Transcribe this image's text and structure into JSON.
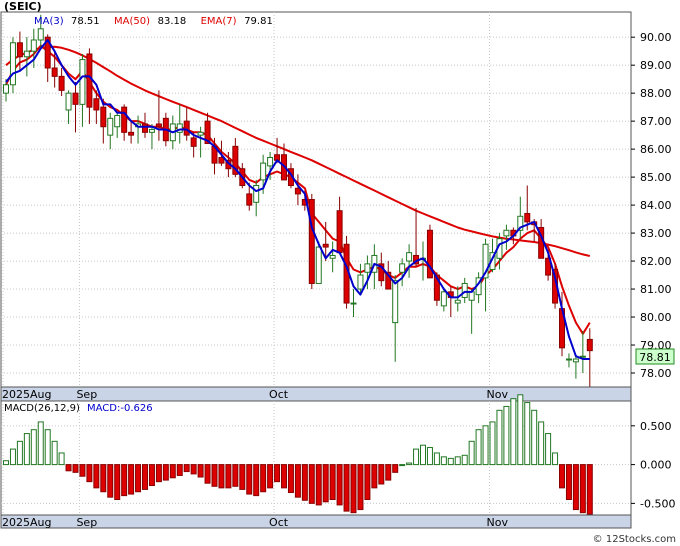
{
  "chart_data": [
    {
      "type": "candlestick",
      "title": "(SEIC)",
      "legend": [
        {
          "label": "MA(3)",
          "value": "78.51",
          "color": "#0000cc"
        },
        {
          "label": "MA(50)",
          "value": "83.18",
          "color": "#dd0000"
        },
        {
          "label": "EMA(7)",
          "value": "79.81",
          "color": "#dd0000"
        }
      ],
      "y_ticks": [
        "90.00",
        "89.00",
        "88.00",
        "87.00",
        "86.00",
        "85.00",
        "84.00",
        "83.00",
        "82.00",
        "81.00",
        "80.00",
        "79.00",
        "78.00"
      ],
      "ylim": [
        77.5,
        90.9
      ],
      "x_labels": [
        "2025Aug",
        "Sep",
        "Oct",
        "Nov"
      ],
      "last_price": "78.81",
      "grid": true,
      "colors": {
        "up_candle": "#ffffff",
        "down_candle": "#dd0000",
        "ma3": "#0000cc",
        "ma50": "#dd0000",
        "grid": "#c8c8c8",
        "last_price_box": "#ccffcc"
      },
      "candles": [
        [
          88.0,
          88.5,
          87.7,
          88.3
        ],
        [
          88.3,
          90.0,
          88.0,
          89.8
        ],
        [
          89.8,
          90.2,
          88.8,
          89.3
        ],
        [
          89.3,
          90.0,
          88.6,
          89.5
        ],
        [
          89.5,
          90.3,
          88.9,
          89.9
        ],
        [
          89.9,
          90.8,
          89.6,
          90.3
        ],
        [
          90.0,
          90.1,
          88.4,
          88.9
        ],
        [
          88.9,
          89.5,
          88.2,
          88.6
        ],
        [
          88.6,
          88.9,
          87.9,
          88.1
        ],
        [
          87.4,
          88.1,
          86.9,
          88.0
        ],
        [
          88.0,
          88.4,
          86.6,
          87.6
        ],
        [
          87.6,
          89.4,
          86.8,
          89.2
        ],
        [
          89.4,
          89.6,
          86.9,
          87.5
        ],
        [
          87.8,
          88.1,
          86.9,
          87.4
        ],
        [
          87.5,
          87.8,
          86.2,
          86.8
        ],
        [
          86.5,
          87.3,
          86.0,
          87.1
        ],
        [
          86.8,
          87.3,
          86.4,
          87.2
        ],
        [
          87.5,
          87.6,
          86.3,
          86.6
        ],
        [
          86.6,
          87.0,
          86.2,
          86.5
        ],
        [
          86.8,
          87.2,
          86.2,
          86.9
        ],
        [
          86.9,
          87.3,
          86.4,
          86.6
        ],
        [
          86.6,
          86.9,
          86.0,
          86.7
        ],
        [
          86.9,
          88.1,
          86.3,
          86.8
        ],
        [
          87.1,
          87.3,
          86.1,
          86.3
        ],
        [
          86.3,
          87.2,
          86.0,
          86.9
        ],
        [
          86.6,
          87.6,
          86.2,
          86.9
        ],
        [
          87.0,
          87.5,
          86.3,
          86.5
        ],
        [
          86.4,
          86.6,
          85.7,
          86.1
        ],
        [
          86.5,
          86.8,
          85.7,
          86.6
        ],
        [
          87.0,
          87.3,
          86.2,
          86.2
        ],
        [
          86.1,
          86.4,
          85.1,
          85.5
        ],
        [
          85.7,
          86.3,
          85.4,
          85.5
        ],
        [
          85.6,
          85.9,
          85.0,
          85.3
        ],
        [
          86.1,
          86.4,
          85.0,
          85.1
        ],
        [
          85.3,
          85.5,
          84.6,
          84.7
        ],
        [
          84.4,
          84.8,
          83.8,
          84.0
        ],
        [
          84.1,
          84.9,
          83.6,
          84.7
        ],
        [
          84.9,
          85.8,
          84.4,
          85.5
        ],
        [
          85.4,
          85.9,
          84.9,
          85.7
        ],
        [
          85.8,
          86.4,
          85.5,
          85.6
        ],
        [
          85.8,
          86.2,
          84.9,
          84.9
        ],
        [
          85.3,
          85.5,
          84.6,
          84.7
        ],
        [
          84.6,
          85.1,
          84.0,
          84.4
        ],
        [
          84.2,
          84.5,
          83.8,
          84.0
        ],
        [
          84.2,
          84.4,
          81.0,
          81.2
        ],
        [
          81.2,
          82.7,
          81.2,
          82.5
        ],
        [
          82.6,
          83.4,
          82.0,
          82.5
        ],
        [
          82.1,
          82.7,
          81.6,
          82.2
        ],
        [
          83.8,
          84.3,
          82.3,
          82.3
        ],
        [
          82.6,
          82.9,
          80.3,
          80.5
        ],
        [
          80.5,
          81.0,
          80.0,
          80.5
        ],
        [
          81.0,
          81.9,
          80.8,
          81.5
        ],
        [
          81.6,
          82.2,
          81.0,
          81.9
        ],
        [
          81.6,
          82.6,
          81.0,
          82.2
        ],
        [
          81.9,
          82.3,
          81.1,
          81.3
        ],
        [
          81.6,
          82.0,
          81.0,
          81.0
        ],
        [
          79.8,
          81.5,
          78.4,
          81.3
        ],
        [
          81.6,
          82.1,
          81.1,
          81.9
        ],
        [
          82.0,
          82.6,
          81.4,
          82.3
        ],
        [
          82.2,
          83.9,
          81.8,
          81.9
        ],
        [
          82.1,
          82.7,
          81.3,
          82.1
        ],
        [
          83.1,
          83.3,
          81.4,
          81.4
        ],
        [
          81.5,
          81.6,
          80.4,
          80.6
        ],
        [
          80.4,
          81.0,
          80.2,
          80.9
        ],
        [
          80.9,
          81.1,
          80.0,
          80.7
        ],
        [
          80.5,
          81.1,
          80.2,
          80.6
        ],
        [
          80.7,
          81.4,
          80.5,
          81.2
        ],
        [
          80.6,
          81.0,
          79.4,
          80.9
        ],
        [
          80.8,
          81.6,
          80.5,
          81.4
        ],
        [
          81.4,
          82.8,
          80.2,
          82.6
        ],
        [
          81.7,
          82.8,
          81.6,
          82.3
        ],
        [
          82.1,
          83.0,
          81.7,
          82.8
        ],
        [
          82.9,
          83.3,
          82.4,
          83.1
        ],
        [
          83.1,
          83.2,
          82.6,
          82.9
        ],
        [
          83.1,
          84.3,
          82.8,
          83.6
        ],
        [
          83.7,
          84.7,
          83.1,
          83.4
        ],
        [
          83.4,
          83.5,
          82.7,
          83.3
        ],
        [
          83.2,
          83.5,
          82.1,
          82.1
        ],
        [
          82.1,
          82.4,
          81.3,
          81.5
        ],
        [
          81.7,
          81.9,
          80.3,
          80.5
        ],
        [
          80.3,
          80.9,
          78.6,
          78.9
        ],
        [
          78.5,
          78.7,
          78.2,
          78.5
        ],
        [
          78.4,
          78.6,
          77.8,
          78.5
        ],
        [
          78.6,
          79.5,
          78.0,
          78.6
        ],
        [
          79.2,
          79.6,
          77.5,
          78.8
        ]
      ],
      "ma3": [
        88.4,
        88.7,
        88.8,
        89.0,
        89.2,
        89.6,
        89.9,
        89.5,
        89.0,
        88.6,
        88.3,
        88.6,
        88.6,
        88.3,
        87.6,
        87.6,
        87.3,
        87.3,
        87.0,
        86.8,
        86.8,
        86.8,
        86.7,
        86.7,
        86.6,
        86.7,
        86.7,
        86.5,
        86.4,
        86.3,
        86.1,
        85.8,
        85.5,
        85.3,
        85.0,
        84.7,
        84.5,
        84.6,
        85.2,
        85.6,
        85.4,
        85.1,
        84.7,
        84.4,
        83.2,
        82.6,
        82.1,
        82.4,
        82.3,
        81.8,
        81.1,
        80.8,
        81.3,
        81.9,
        81.8,
        81.5,
        81.2,
        81.4,
        81.8,
        82.0,
        82.1,
        81.8,
        81.4,
        81.0,
        80.7,
        80.7,
        80.9,
        80.9,
        81.2,
        81.6,
        82.1,
        82.6,
        82.7,
        82.9,
        83.2,
        83.3,
        83.4,
        82.9,
        82.3,
        81.4,
        80.3,
        79.3,
        78.6,
        78.5,
        78.5
      ],
      "ma50": [
        89.0,
        89.2,
        89.35,
        89.45,
        89.55,
        89.62,
        89.65,
        89.66,
        89.62,
        89.55,
        89.46,
        89.35,
        89.22,
        89.08,
        88.93,
        88.78,
        88.62,
        88.48,
        88.34,
        88.22,
        88.1,
        87.99,
        87.89,
        87.79,
        87.69,
        87.6,
        87.5,
        87.4,
        87.3,
        87.2,
        87.1,
        87.0,
        86.88,
        86.76,
        86.64,
        86.52,
        86.4,
        86.3,
        86.2,
        86.1,
        86.0,
        85.9,
        85.8,
        85.7,
        85.6,
        85.48,
        85.36,
        85.24,
        85.12,
        85.0,
        84.88,
        84.76,
        84.64,
        84.52,
        84.4,
        84.28,
        84.16,
        84.04,
        83.92,
        83.8,
        83.7,
        83.6,
        83.5,
        83.4,
        83.3,
        83.2,
        83.12,
        83.06,
        83.0,
        82.94,
        82.88,
        82.84,
        82.8,
        82.77,
        82.74,
        82.71,
        82.68,
        82.64,
        82.59,
        82.53,
        82.46,
        82.39,
        82.31,
        82.24,
        82.18
      ],
      "ema7": [
        88.3,
        88.8,
        89.1,
        89.2,
        89.4,
        89.7,
        89.5,
        89.3,
        89.0,
        88.7,
        88.5,
        88.8,
        88.4,
        88.0,
        87.7,
        87.5,
        87.4,
        87.2,
        87.0,
        87.0,
        86.9,
        86.8,
        86.8,
        86.7,
        86.7,
        86.8,
        86.7,
        86.6,
        86.6,
        86.5,
        86.2,
        85.9,
        85.7,
        85.5,
        85.2,
        84.9,
        84.8,
        85.0,
        85.1,
        85.2,
        85.1,
        85.0,
        84.8,
        84.6,
        83.7,
        83.4,
        83.1,
        82.8,
        82.7,
        82.1,
        81.7,
        81.6,
        81.7,
        81.8,
        81.7,
        81.5,
        81.4,
        81.6,
        81.8,
        81.8,
        81.9,
        81.8,
        81.5,
        81.3,
        81.1,
        81.0,
        81.1,
        81.0,
        81.1,
        81.5,
        81.7,
        82.0,
        82.3,
        82.5,
        82.8,
        83.0,
        83.1,
        82.8,
        82.5,
        81.9,
        81.1,
        80.4,
        79.8,
        79.4,
        79.8
      ]
    },
    {
      "type": "bar",
      "title": "MACD(26,12,9)",
      "legend_label": "MACD:-0.626",
      "y_ticks": [
        "0.500",
        "0.000",
        "-0.500"
      ],
      "ylim": [
        -0.65,
        0.82
      ],
      "x_labels": [
        "2025Aug",
        "Sep",
        "Oct",
        "Nov"
      ],
      "colors": {
        "positive": "#ffffff",
        "negative": "#dd0000"
      },
      "values": [
        0.05,
        0.2,
        0.3,
        0.4,
        0.45,
        0.55,
        0.45,
        0.3,
        0.15,
        -0.08,
        -0.1,
        -0.15,
        -0.22,
        -0.3,
        -0.35,
        -0.42,
        -0.45,
        -0.4,
        -0.38,
        -0.35,
        -0.32,
        -0.27,
        -0.22,
        -0.2,
        -0.17,
        -0.14,
        -0.09,
        -0.12,
        -0.16,
        -0.24,
        -0.28,
        -0.3,
        -0.3,
        -0.28,
        -0.32,
        -0.38,
        -0.4,
        -0.35,
        -0.3,
        -0.22,
        -0.3,
        -0.36,
        -0.42,
        -0.46,
        -0.5,
        -0.52,
        -0.48,
        -0.45,
        -0.52,
        -0.6,
        -0.62,
        -0.58,
        -0.45,
        -0.3,
        -0.25,
        -0.2,
        -0.1,
        0,
        0.02,
        0.2,
        0.25,
        0.22,
        0.15,
        0.1,
        0.08,
        0.1,
        0.12,
        0.3,
        0.45,
        0.5,
        0.55,
        0.7,
        0.75,
        0.85,
        0.9,
        0.8,
        0.7,
        0.55,
        0.4,
        0.15,
        -0.3,
        -0.45,
        -0.58,
        -0.62,
        -0.64
      ]
    }
  ],
  "watermark": "© 12Stocks.com"
}
